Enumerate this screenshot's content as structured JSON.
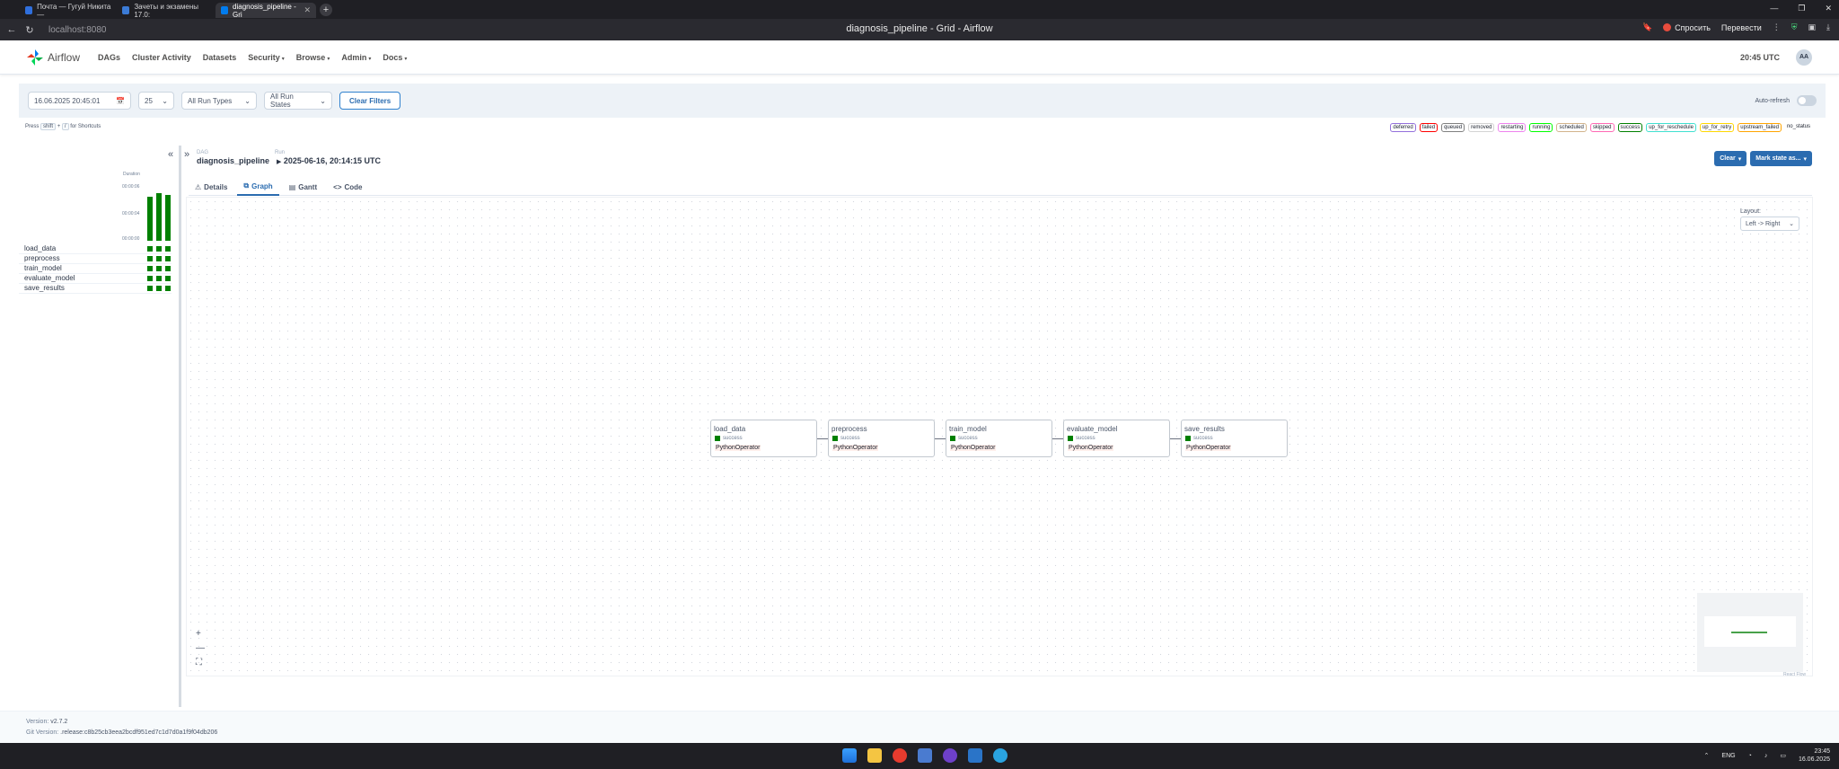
{
  "browser": {
    "tabs": [
      {
        "label": "Почта — Гугуй Никита —",
        "color": "#2f6fdd"
      },
      {
        "label": "Зачеты и экзамены 17.0:",
        "color": "#3b7bd6"
      },
      {
        "label": "diagnosis_pipeline - Gri",
        "color": "#017cee"
      }
    ],
    "url": "localhost:8080",
    "page_title": "diagnosis_pipeline - Grid - Airflow",
    "ask_label": "Спросить",
    "translate_label": "Перевести"
  },
  "nav": {
    "logo_text": "Airflow",
    "items": [
      "DAGs",
      "Cluster Activity",
      "Datasets",
      "Security",
      "Browse",
      "Admin",
      "Docs"
    ],
    "time": "20:45 UTC",
    "avatar": "AA"
  },
  "filters": {
    "date": "16.06.2025 20:45:01",
    "num_runs": "25",
    "run_types": "All Run Types",
    "run_states": "All Run States",
    "clear_label": "Clear Filters",
    "auto_refresh": "Auto-refresh"
  },
  "shortcuts": {
    "press": "Press",
    "key1": "shift",
    "plus": "+",
    "key2": "/",
    "suffix": "for Shortcuts"
  },
  "legend": [
    {
      "label": "deferred",
      "color": "#9370db"
    },
    {
      "label": "failed",
      "color": "#ff0000"
    },
    {
      "label": "queued",
      "color": "#808080"
    },
    {
      "label": "removed",
      "color": "#d3d3d3"
    },
    {
      "label": "restarting",
      "color": "#ee82ee"
    },
    {
      "label": "running",
      "color": "#00ff00"
    },
    {
      "label": "scheduled",
      "color": "#d2b48c"
    },
    {
      "label": "skipped",
      "color": "#ff69b4"
    },
    {
      "label": "success",
      "color": "#008000"
    },
    {
      "label": "up_for_reschedule",
      "color": "#40e0d0"
    },
    {
      "label": "up_for_retry",
      "color": "#ffd700"
    },
    {
      "label": "upstream_failed",
      "color": "#ffa500"
    },
    {
      "label": "no_status",
      "color": "#ffffff"
    }
  ],
  "grid": {
    "duration_label": "Duration",
    "ticks": [
      "00:00:06",
      "00:00:04",
      "00:00:00"
    ],
    "run_durations": [
      0.82,
      0.88,
      0.85
    ],
    "tasks": [
      "load_data",
      "preprocess",
      "train_model",
      "evaluate_model",
      "save_results"
    ]
  },
  "details": {
    "dag_label": "DAG",
    "dag_name": "diagnosis_pipeline",
    "run_label": "Run",
    "run_name": "2025-06-16, 20:14:15 UTC",
    "clear_btn": "Clear",
    "mark_btn": "Mark state as...",
    "tabs": [
      "Details",
      "Graph",
      "Gantt",
      "Code"
    ],
    "layout_label": "Layout:",
    "layout_value": "Left -> Right",
    "nodes": [
      {
        "name": "load_data",
        "state": "success",
        "operator": "PythonOperator"
      },
      {
        "name": "preprocess",
        "state": "success",
        "operator": "PythonOperator"
      },
      {
        "name": "train_model",
        "state": "success",
        "operator": "PythonOperator"
      },
      {
        "name": "evaluate_model",
        "state": "success",
        "operator": "PythonOperator"
      },
      {
        "name": "save_results",
        "state": "success",
        "operator": "PythonOperator"
      }
    ],
    "react_flow": "React Flow"
  },
  "footer": {
    "version_label": "Version:",
    "version": "v2.7.2",
    "git_label": "Git Version:",
    "git": ".release:c8b25cb3eea2bcdf951ed7c1d7d0a1f9f04db206"
  },
  "taskbar": {
    "lang": "ENG",
    "time": "23:45",
    "date": "16.06.2025"
  }
}
